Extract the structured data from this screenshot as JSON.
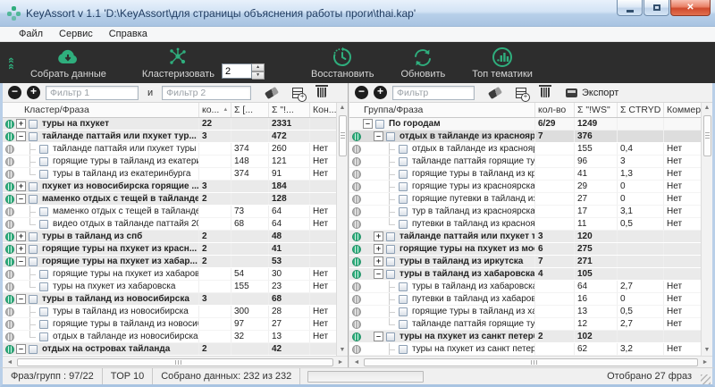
{
  "window": {
    "title": "KeyAssort v 1.1  'D:\\KeyAssort\\для страницы объяснения работы проги\\thai.kap'",
    "close_glyph": "✕"
  },
  "menu": [
    "Файл",
    "Сервис",
    "Справка"
  ],
  "toolbar": {
    "collect_label": "Собрать данные",
    "clusterize_label": "Кластеризовать",
    "cluster_count_value": "2",
    "restore_label": "Восстановить",
    "refresh_label": "Обновить",
    "top_topics_label": "Топ тематики"
  },
  "colors": {
    "accent_green": "#2fae7d",
    "toolbar_bg": "#2d2d2d"
  },
  "left_panel": {
    "filter": {
      "minus": "−",
      "plus": "+",
      "input1_placeholder": "Фильтр 1",
      "conjunction": "и",
      "input2_placeholder": "Фильтр 2"
    },
    "headers": [
      "Кластер/Фраза",
      "ко...",
      "Σ [...",
      "Σ \"!...",
      "Кон..."
    ],
    "sorted_header_index": 1,
    "sort_arrow": "▲",
    "rows": [
      {
        "kind": "cluster",
        "exp": "+",
        "level": 0,
        "label": "туры на пхукет",
        "cols": [
          "22",
          "",
          "2331",
          ""
        ]
      },
      {
        "kind": "cluster",
        "exp": "-",
        "level": 0,
        "label": "тайланде паттайя или пхукет тур...",
        "cols": [
          "3",
          "",
          "472",
          ""
        ]
      },
      {
        "kind": "phrase",
        "level": 1,
        "label": "тайланде паттайя или пхукет туры ...",
        "cols": [
          "",
          "374",
          "260",
          "Нет"
        ]
      },
      {
        "kind": "phrase",
        "level": 1,
        "label": "горящие туры в тайланд из екатери...",
        "cols": [
          "",
          "148",
          "121",
          "Нет"
        ]
      },
      {
        "kind": "phrase",
        "level": 1,
        "last": true,
        "label": "туры в тайланд из екатеринбурга",
        "cols": [
          "",
          "374",
          "91",
          "Нет"
        ]
      },
      {
        "kind": "cluster",
        "exp": "+",
        "level": 0,
        "label": "пхукет из новосибирска горящие ...",
        "cols": [
          "3",
          "",
          "184",
          ""
        ]
      },
      {
        "kind": "cluster",
        "exp": "-",
        "level": 0,
        "label": "маменко отдых с тещей в тайланде",
        "cols": [
          "2",
          "",
          "128",
          ""
        ]
      },
      {
        "kind": "phrase",
        "level": 1,
        "label": "маменко отдых с тещей в тайланде",
        "cols": [
          "",
          "73",
          "64",
          "Нет"
        ]
      },
      {
        "kind": "phrase",
        "level": 1,
        "last": true,
        "label": "видео отдых в тайланде паттайя 20...",
        "cols": [
          "",
          "68",
          "64",
          "Нет"
        ]
      },
      {
        "kind": "cluster",
        "exp": "+",
        "level": 0,
        "label": "туры в тайланд из спб",
        "cols": [
          "2",
          "",
          "48",
          ""
        ]
      },
      {
        "kind": "cluster",
        "exp": "+",
        "level": 0,
        "label": "горящие туры на пхукет из красн...",
        "cols": [
          "2",
          "",
          "41",
          ""
        ]
      },
      {
        "kind": "cluster",
        "exp": "-",
        "level": 0,
        "label": "горящие туры на пхукет из хабар...",
        "cols": [
          "2",
          "",
          "53",
          ""
        ]
      },
      {
        "kind": "phrase",
        "level": 1,
        "label": "горящие туры на пхукет из хабаров...",
        "cols": [
          "",
          "54",
          "30",
          "Нет"
        ]
      },
      {
        "kind": "phrase",
        "level": 1,
        "last": true,
        "label": "туры на пхукет из хабаровска",
        "cols": [
          "",
          "155",
          "23",
          "Нет"
        ]
      },
      {
        "kind": "cluster",
        "exp": "-",
        "level": 0,
        "label": "туры в тайланд из новосибирска",
        "cols": [
          "3",
          "",
          "68",
          ""
        ]
      },
      {
        "kind": "phrase",
        "level": 1,
        "label": "туры в тайланд из новосибирска",
        "cols": [
          "",
          "300",
          "28",
          "Нет"
        ]
      },
      {
        "kind": "phrase",
        "level": 1,
        "label": "горящие туры в тайланд из новосиб...",
        "cols": [
          "",
          "97",
          "27",
          "Нет"
        ]
      },
      {
        "kind": "phrase",
        "level": 1,
        "last": true,
        "label": "отдых в тайланде из новосибирска ...",
        "cols": [
          "",
          "32",
          "13",
          "Нет"
        ]
      },
      {
        "kind": "cluster",
        "exp": "-",
        "level": 0,
        "label": "отдых на островах тайланда",
        "cols": [
          "2",
          "",
          "42",
          ""
        ]
      }
    ]
  },
  "right_panel": {
    "filter": {
      "minus": "−",
      "plus": "+",
      "input_placeholder": "Фильтр",
      "export_label": "Экспорт"
    },
    "headers": [
      "Группа/Фраза",
      "кол-во",
      "Σ \"!WS\"",
      "Σ CTRYD",
      "Коммер."
    ],
    "rows": [
      {
        "kind": "top",
        "exp": "-",
        "level": 0,
        "label": "По городам",
        "cols": [
          "6/29",
          "1249",
          "",
          ""
        ]
      },
      {
        "kind": "group",
        "exp": "-",
        "level": 1,
        "sel": true,
        "label": "отдых в тайланде из красноярска",
        "cols": [
          "7",
          "376",
          "",
          ""
        ]
      },
      {
        "kind": "phrase",
        "level": 2,
        "label": "отдых в тайланде из красноярска",
        "cols": [
          "",
          "155",
          "0,4",
          "Нет"
        ]
      },
      {
        "kind": "phrase",
        "level": 2,
        "label": "тайланде паттайя горящие туры ...",
        "cols": [
          "",
          "96",
          "3",
          "Нет"
        ]
      },
      {
        "kind": "phrase",
        "level": 2,
        "label": "горящие туры в тайланд из красн...",
        "cols": [
          "",
          "41",
          "1,3",
          "Нет"
        ]
      },
      {
        "kind": "phrase",
        "level": 2,
        "label": "горящие туры из красноярска в т...",
        "cols": [
          "",
          "29",
          "0",
          "Нет"
        ]
      },
      {
        "kind": "phrase",
        "level": 2,
        "label": "горящие путевки в тайланд из кр...",
        "cols": [
          "",
          "27",
          "0",
          "Нет"
        ]
      },
      {
        "kind": "phrase",
        "level": 2,
        "label": "тур в тайланд из красноярска",
        "cols": [
          "",
          "17",
          "3,1",
          "Нет"
        ]
      },
      {
        "kind": "phrase",
        "level": 2,
        "last": true,
        "label": "путевки в тайланд из красноярска",
        "cols": [
          "",
          "11",
          "0,5",
          "Нет"
        ]
      },
      {
        "kind": "group",
        "exp": "+",
        "level": 1,
        "label": "тайланде паттайя или пхукет т...",
        "cols": [
          "3",
          "120",
          "",
          ""
        ]
      },
      {
        "kind": "group",
        "exp": "+",
        "level": 1,
        "label": "горящие туры на пхукет из мос...",
        "cols": [
          "6",
          "275",
          "",
          ""
        ]
      },
      {
        "kind": "group",
        "exp": "+",
        "level": 1,
        "label": "туры в тайланд из иркутска",
        "cols": [
          "7",
          "271",
          "",
          ""
        ]
      },
      {
        "kind": "group",
        "exp": "-",
        "level": 1,
        "label": "туры в тайланд из хабаровска",
        "cols": [
          "4",
          "105",
          "",
          ""
        ]
      },
      {
        "kind": "phrase",
        "level": 2,
        "label": "туры в тайланд из хабаровска",
        "cols": [
          "",
          "64",
          "2,7",
          "Нет"
        ]
      },
      {
        "kind": "phrase",
        "level": 2,
        "label": "путевки в тайланд из хабаровска",
        "cols": [
          "",
          "16",
          "0",
          "Нет"
        ]
      },
      {
        "kind": "phrase",
        "level": 2,
        "label": "горящие туры в тайланд из хабар...",
        "cols": [
          "",
          "13",
          "0,5",
          "Нет"
        ]
      },
      {
        "kind": "phrase",
        "level": 2,
        "last": true,
        "label": "тайланде паттайя горящие туры ...",
        "cols": [
          "",
          "12",
          "2,7",
          "Нет"
        ]
      },
      {
        "kind": "group",
        "exp": "-",
        "level": 1,
        "label": "туры на пхукет из санкт петерб...",
        "cols": [
          "2",
          "102",
          "",
          ""
        ]
      },
      {
        "kind": "phrase",
        "level": 2,
        "label": "туры на пхукет из санкт петербурга",
        "cols": [
          "",
          "62",
          "3,2",
          "Нет"
        ]
      }
    ]
  },
  "statusbar": {
    "segments": [
      "Фраз/групп :  97/22",
      "TOP 10",
      "Собрано данных:  232 из 232"
    ],
    "right_text": "Отобрано 27 фраз"
  }
}
